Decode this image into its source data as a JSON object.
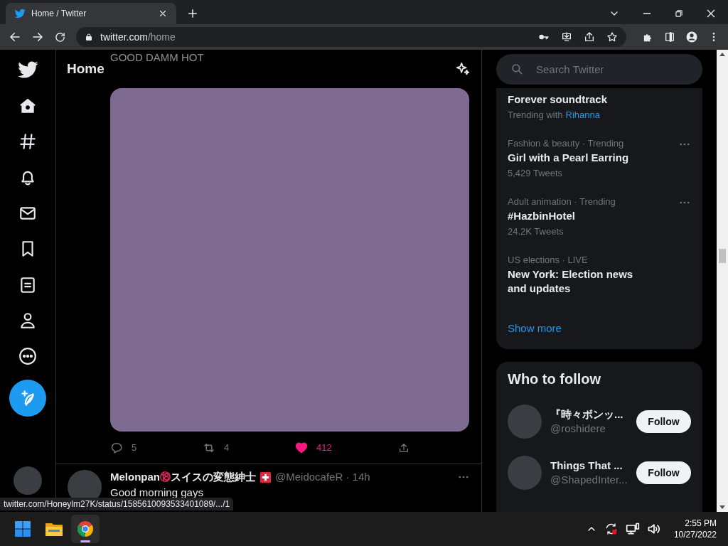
{
  "browser": {
    "tabs": [
      {
        "title": "Home / Twitter",
        "selected": true
      }
    ],
    "address": {
      "host": "twitter.com",
      "path": "/home"
    }
  },
  "header": {
    "title": "Home"
  },
  "feed": [
    {
      "kind": "media",
      "caption": "GOOD DAMM HOT",
      "actions": {
        "replies": "5",
        "retweets": "4",
        "likes": "412",
        "liked": true
      }
    },
    {
      "kind": "tweet",
      "name": "Melonpan",
      "age_badge": "⑱",
      "name_tail": "スイスの変態紳士",
      "handle": "@MeidocafeR",
      "separator": "·",
      "time": "14h",
      "text": "Good morning gays"
    }
  ],
  "search": {
    "placeholder": "Search Twitter"
  },
  "trends": [
    {
      "title": "Forever soundtrack",
      "with_label": "Trending with",
      "with_link": "Rihanna",
      "has_menu": false
    },
    {
      "context": "Fashion & beauty · Trending",
      "title": "Girl with a Pearl Earring",
      "count": "5,429 Tweets",
      "has_menu": true
    },
    {
      "context": "Adult animation · Trending",
      "title": "#HazbinHotel",
      "count": "24.2K Tweets",
      "has_menu": true
    },
    {
      "context": "US elections · LIVE",
      "title": "New York: Election news and updates",
      "has_menu": false
    }
  ],
  "show_more": "Show more",
  "who_to_follow": {
    "title": "Who to follow",
    "users": [
      {
        "name": "『時々ボンッ...",
        "handle": "@roshidere",
        "button": "Follow"
      },
      {
        "name": "Things That ...",
        "handle": "@ShapedInter...",
        "button": "Follow"
      }
    ]
  },
  "status_url": "twitter.com/Honeylm27K/status/1585610093533401089/.../1",
  "taskbar": {
    "apps": [
      {
        "kind": "start",
        "selected": false
      },
      {
        "kind": "explorer",
        "selected": false
      },
      {
        "kind": "chrome",
        "selected": true
      }
    ],
    "time": "2:55 PM",
    "date": "10/27/2022"
  }
}
